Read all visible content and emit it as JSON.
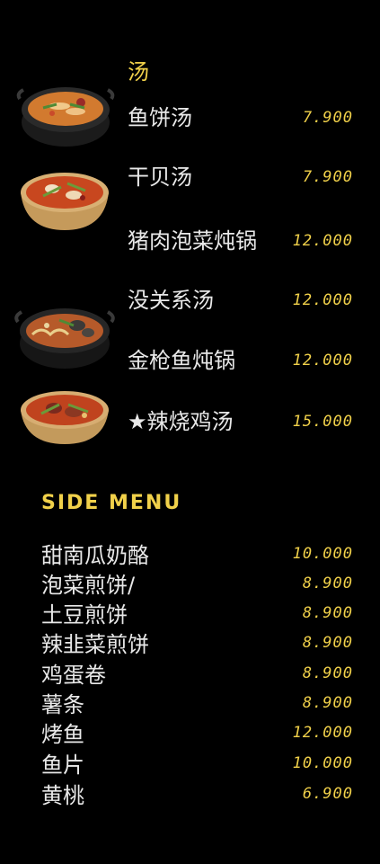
{
  "soup": {
    "title": "汤",
    "items": [
      {
        "name": "鱼饼汤",
        "price": "7.900"
      },
      {
        "name": "干贝汤",
        "price": "7.900"
      },
      {
        "name": "猪肉泡菜炖锅",
        "price": "12.000"
      },
      {
        "name": "没关系汤",
        "price": "12.000"
      },
      {
        "name": "金枪鱼炖锅",
        "price": "12.000"
      },
      {
        "name": "★辣烧鸡汤",
        "price": "15.000"
      }
    ]
  },
  "side": {
    "title": "SIDE MENU",
    "items": [
      {
        "name": "甜南瓜奶酪",
        "price": "10.000"
      },
      {
        "name": "泡菜煎饼/",
        "price": "8.900"
      },
      {
        "name": "土豆煎饼",
        "price": "8.900"
      },
      {
        "name": "辣韭菜煎饼",
        "price": "8.900"
      },
      {
        "name": "鸡蛋卷",
        "price": "8.900"
      },
      {
        "name": "薯条",
        "price": "8.900"
      },
      {
        "name": "烤鱼",
        "price": "12.000"
      },
      {
        "name": "鱼片",
        "price": "10.000"
      },
      {
        "name": "黄桃",
        "price": "6.900"
      }
    ]
  },
  "photos": [
    {
      "icon": "fishcake-soup-pot-icon"
    },
    {
      "icon": "scallop-soup-bowl-icon"
    },
    {
      "icon": "budae-jjigae-pot-icon"
    },
    {
      "icon": "spicy-chicken-soup-bowl-icon"
    }
  ],
  "colors": {
    "background": "#000000",
    "accent": "#f1d14a",
    "text": "#e8e8e8"
  }
}
